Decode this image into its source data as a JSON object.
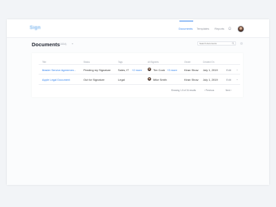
{
  "app": {
    "logo_text": "Sign",
    "nav": [
      {
        "label": "Documents",
        "active": true
      },
      {
        "label": "Templates",
        "active": false
      },
      {
        "label": "Reports",
        "active": false
      }
    ],
    "accent_color": "#2f80ed"
  },
  "page": {
    "title": "Documents",
    "count": "(1534)",
    "search_placeholder": "Search documents"
  },
  "table": {
    "columns": [
      "Title",
      "Status",
      "Tags",
      "All Signees",
      "Owner",
      "Created On"
    ],
    "rows": [
      {
        "title": "Master Service Agreemen...",
        "status": "Pending my Signature",
        "tags": "Sales, IT",
        "tags_more": "+2 more",
        "signee": "Tim Cook",
        "signee_more": "+3 more",
        "owner": "Kiran Show",
        "created": "July 1, 2019",
        "edit": "Edit"
      },
      {
        "title": "Apple Legal Document",
        "status": "Out for Signature",
        "tags": "Legal",
        "tags_more": "",
        "signee": "Mike Smith",
        "signee_more": "",
        "owner": "Kiran Show",
        "created": "July 1, 2019",
        "edit": "Edit"
      }
    ],
    "footer": {
      "showing": "Showing 1-5 of 34 results",
      "previous": "‹ Previous",
      "next": "Next ›"
    }
  }
}
